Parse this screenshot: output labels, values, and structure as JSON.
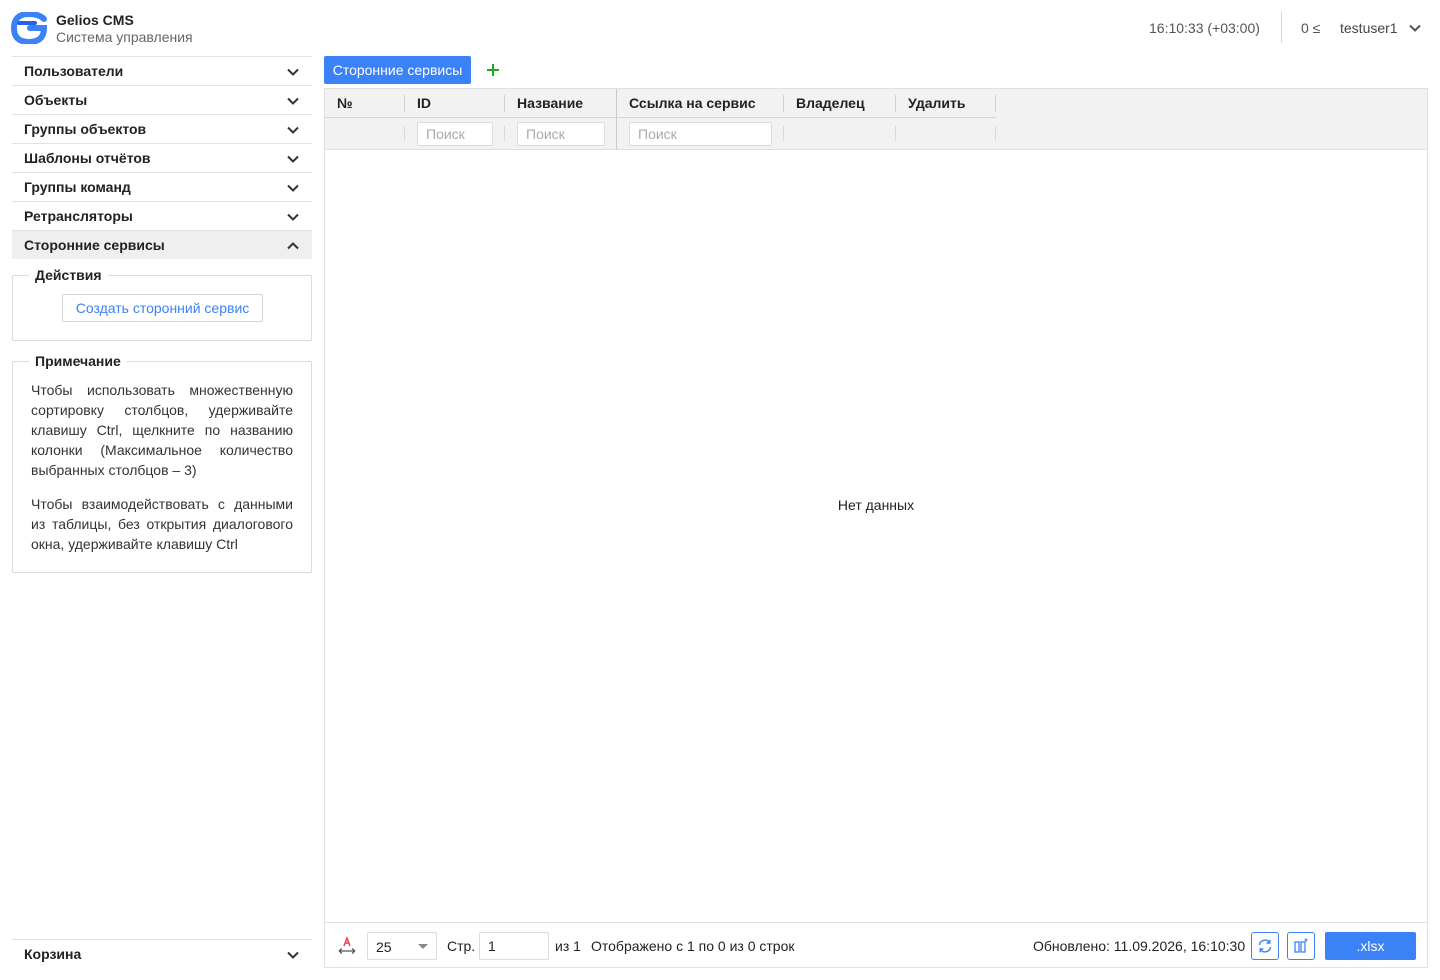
{
  "header": {
    "app_title": "Gelios CMS",
    "app_subtitle": "Система управления",
    "clock": "16:10:33 (+03:00)",
    "notifications": "0 ≤",
    "username": "testuser1"
  },
  "sidebar": {
    "items": [
      {
        "label": "Пользователи",
        "expanded": false
      },
      {
        "label": "Объекты",
        "expanded": false
      },
      {
        "label": "Группы объектов",
        "expanded": false
      },
      {
        "label": "Шаблоны отчётов",
        "expanded": false
      },
      {
        "label": "Группы команд",
        "expanded": false
      },
      {
        "label": "Ретрансляторы",
        "expanded": false
      },
      {
        "label": "Сторонние сервисы",
        "expanded": true
      }
    ],
    "actions": {
      "title": "Действия",
      "create_button": "Создать сторонний сервис"
    },
    "note": {
      "title": "Примечание",
      "paragraph1": "Чтобы использовать множественную сортировку столбцов, удерживайте клавишу Ctrl, щелкните по названию колонки (Максимальное количество выбранных столбцов – 3)",
      "paragraph2": "Чтобы взаимодействовать с данными из таблицы, без открытия диалогового окна, удерживайте клавишу Ctrl"
    },
    "basket": {
      "label": "Корзина"
    }
  },
  "tabs": {
    "active": "Сторонние сервисы",
    "add_icon": "plus-icon"
  },
  "table": {
    "columns": [
      {
        "label": "№"
      },
      {
        "label": "ID",
        "filter_placeholder": "Поиск"
      },
      {
        "label": "Название",
        "filter_placeholder": "Поиск"
      },
      {
        "label": "Ссылка на сервис",
        "filter_placeholder": "Поиск"
      },
      {
        "label": "Владелец"
      },
      {
        "label": "Удалить"
      }
    ],
    "rows": [],
    "empty_text": "Нет данных"
  },
  "footer": {
    "page_size": "25",
    "page_label": "Стр.",
    "page_value": "1",
    "of_pages": "из 1",
    "shown": "Отображено с 1 по 0 из 0 строк",
    "updated": "Обновлено: 11.09.2026, 16:10:30",
    "export_button": ".xlsx"
  },
  "colors": {
    "accent": "#3b82f6",
    "add_icon": "#22aa22",
    "header_bg": "#f2f2f2"
  }
}
